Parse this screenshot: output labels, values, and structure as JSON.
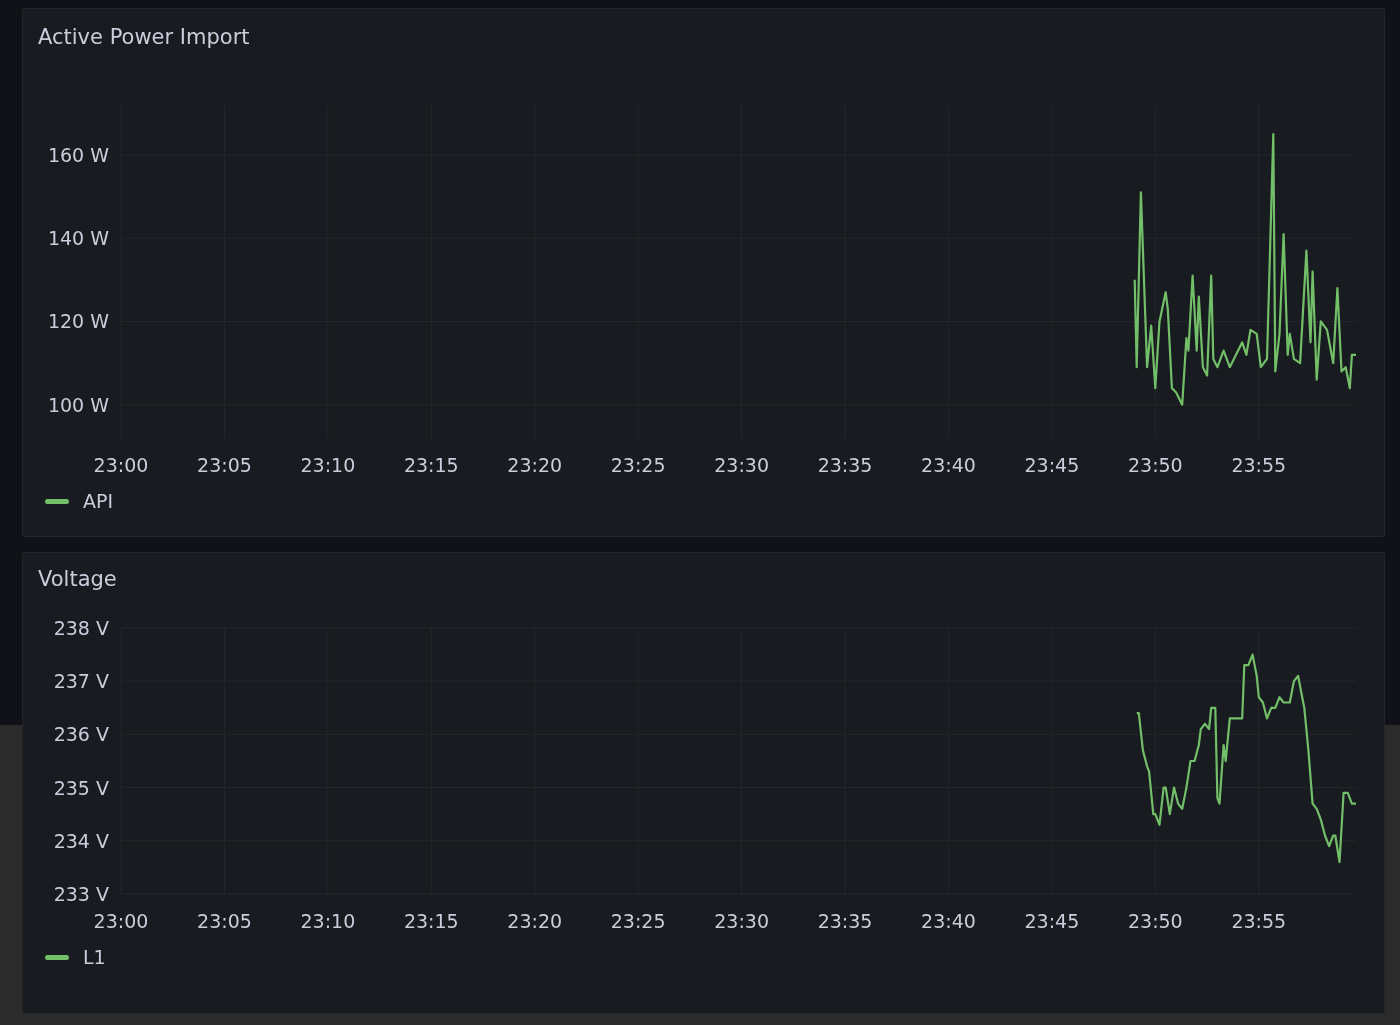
{
  "panels": [
    {
      "title": "Active Power Import",
      "chart_data": {
        "type": "line",
        "grid": true,
        "x": [
          1429.0,
          1429.1,
          1429.3,
          1429.5,
          1429.6,
          1429.8,
          1430.0,
          1430.2,
          1430.5,
          1430.6,
          1430.8,
          1431.0,
          1431.3,
          1431.5,
          1431.6,
          1431.8,
          1432.0,
          1432.1,
          1432.3,
          1432.5,
          1432.7,
          1432.8,
          1433.0,
          1433.3,
          1433.6,
          1433.9,
          1434.2,
          1434.4,
          1434.6,
          1434.9,
          1435.1,
          1435.4,
          1435.7,
          1435.8,
          1436.0,
          1436.2,
          1436.4,
          1436.5,
          1436.7,
          1437.0,
          1437.3,
          1437.5,
          1437.6,
          1437.8,
          1438.0,
          1438.3,
          1438.6,
          1438.8,
          1439.0,
          1439.2,
          1439.4,
          1439.5,
          1439.7
        ],
        "xlim": [
          1380,
          1439.7
        ],
        "ylim": [
          92,
          172
        ],
        "xticks": [
          {
            "value": 1380,
            "label": "23:00"
          },
          {
            "value": 1385,
            "label": "23:05"
          },
          {
            "value": 1390,
            "label": "23:10"
          },
          {
            "value": 1395,
            "label": "23:15"
          },
          {
            "value": 1400,
            "label": "23:20"
          },
          {
            "value": 1405,
            "label": "23:25"
          },
          {
            "value": 1410,
            "label": "23:30"
          },
          {
            "value": 1415,
            "label": "23:35"
          },
          {
            "value": 1420,
            "label": "23:40"
          },
          {
            "value": 1425,
            "label": "23:45"
          },
          {
            "value": 1430,
            "label": "23:50"
          },
          {
            "value": 1435,
            "label": "23:55"
          }
        ],
        "yticks": [
          {
            "value": 100,
            "label": "100 W"
          },
          {
            "value": 120,
            "label": "120 W"
          },
          {
            "value": 140,
            "label": "140 W"
          },
          {
            "value": 160,
            "label": "160 W"
          }
        ],
        "series": [
          {
            "name": "API",
            "color": "#73bf69",
            "values": [
              130,
              109,
              151,
              123,
              109,
              119,
              104,
              120,
              127,
              123,
              104,
              103,
              100,
              116,
              113,
              131,
              113,
              126,
              109,
              107,
              131,
              111,
              109,
              113,
              109,
              112,
              115,
              112,
              118,
              117,
              109,
              111,
              165,
              108,
              117,
              141,
              112,
              117,
              111,
              110,
              137,
              115,
              132,
              106,
              120,
              118,
              110,
              128,
              108,
              109,
              104,
              112,
              112
            ]
          }
        ]
      }
    },
    {
      "title": "Voltage",
      "chart_data": {
        "type": "line",
        "grid": true,
        "x": [
          1429.1,
          1429.2,
          1429.4,
          1429.6,
          1429.7,
          1429.9,
          1430.0,
          1430.2,
          1430.4,
          1430.5,
          1430.7,
          1430.9,
          1431.1,
          1431.3,
          1431.5,
          1431.7,
          1431.9,
          1432.1,
          1432.2,
          1432.4,
          1432.6,
          1432.7,
          1432.9,
          1433.0,
          1433.1,
          1433.3,
          1433.4,
          1433.6,
          1433.9,
          1434.2,
          1434.3,
          1434.5,
          1434.7,
          1434.9,
          1435.0,
          1435.2,
          1435.4,
          1435.6,
          1435.8,
          1436.0,
          1436.2,
          1436.5,
          1436.7,
          1436.9,
          1437.1,
          1437.2,
          1437.4,
          1437.6,
          1437.8,
          1438.0,
          1438.2,
          1438.4,
          1438.6,
          1438.7,
          1438.9,
          1439.1,
          1439.3,
          1439.5,
          1439.7
        ],
        "xlim": [
          1380,
          1439.7
        ],
        "ylim": [
          233,
          238
        ],
        "xticks": [
          {
            "value": 1380,
            "label": "23:00"
          },
          {
            "value": 1385,
            "label": "23:05"
          },
          {
            "value": 1390,
            "label": "23:10"
          },
          {
            "value": 1395,
            "label": "23:15"
          },
          {
            "value": 1400,
            "label": "23:20"
          },
          {
            "value": 1405,
            "label": "23:25"
          },
          {
            "value": 1410,
            "label": "23:30"
          },
          {
            "value": 1415,
            "label": "23:35"
          },
          {
            "value": 1420,
            "label": "23:40"
          },
          {
            "value": 1425,
            "label": "23:45"
          },
          {
            "value": 1430,
            "label": "23:50"
          },
          {
            "value": 1435,
            "label": "23:55"
          }
        ],
        "yticks": [
          {
            "value": 233,
            "label": "233 V"
          },
          {
            "value": 234,
            "label": "234 V"
          },
          {
            "value": 235,
            "label": "235 V"
          },
          {
            "value": 236,
            "label": "236 V"
          },
          {
            "value": 237,
            "label": "237 V"
          },
          {
            "value": 238,
            "label": "238 V"
          }
        ],
        "series": [
          {
            "name": "L1",
            "color": "#73bf69",
            "values": [
              236.4,
              236.4,
              235.7,
              235.4,
              235.3,
              234.5,
              234.5,
              234.3,
              235.0,
              235.0,
              234.5,
              235.0,
              234.7,
              234.6,
              235.0,
              235.5,
              235.5,
              235.8,
              236.1,
              236.2,
              236.1,
              236.5,
              236.5,
              234.8,
              234.7,
              235.8,
              235.5,
              236.3,
              236.3,
              236.3,
              237.3,
              237.3,
              237.5,
              237.1,
              236.7,
              236.6,
              236.3,
              236.5,
              236.5,
              236.7,
              236.6,
              236.6,
              237.0,
              237.1,
              236.7,
              236.5,
              235.7,
              234.7,
              234.6,
              234.4,
              234.1,
              233.9,
              234.1,
              234.1,
              233.6,
              234.9,
              234.9,
              234.7,
              234.7
            ]
          }
        ]
      }
    }
  ]
}
